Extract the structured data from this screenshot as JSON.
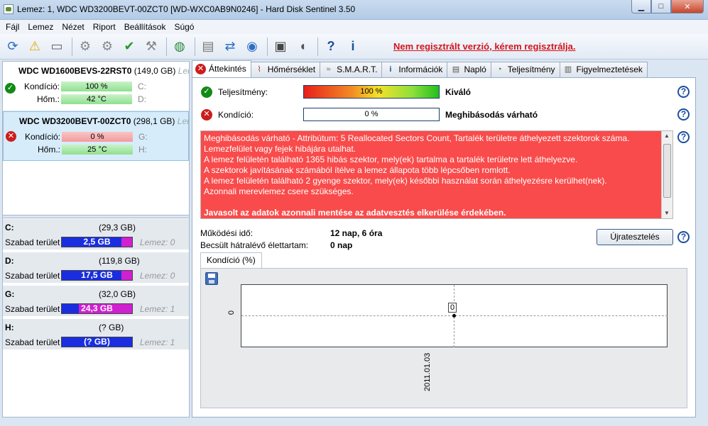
{
  "window": {
    "title": "Lemez: 1, WDC WD3200BEVT-00ZCT0 [WD-WXC0AB9N0246]  -  Hard Disk Sentinel 3.50"
  },
  "menu": [
    "Fájl",
    "Lemez",
    "Nézet",
    "Riport",
    "Beállítások",
    "Súgó"
  ],
  "toolbar": {
    "register_link": "Nem regisztrált verzió, kérem regisztrálja."
  },
  "disks": [
    {
      "name": "WDC WD1600BEVS-22RST0",
      "size": "(149,0 GB)",
      "extra": "Lem",
      "condition_label": "Kondíció:",
      "condition": "100 %",
      "temp_label": "Hőm.:",
      "temp": "42 °C",
      "drive1": "C:",
      "drive2": "D:"
    },
    {
      "name": "WDC WD3200BEVT-00ZCT0",
      "size": "(298,1 GB)",
      "extra": "Lem",
      "condition_label": "Kondíció:",
      "condition": "0 %",
      "temp_label": "Hőm.:",
      "temp": "25 °C",
      "drive1": "G:",
      "drive2": "H:"
    }
  ],
  "volumes": [
    {
      "letter": "C:",
      "size": "(29,3 GB)",
      "free_label": "Szabad terület",
      "free": "2,5 GB",
      "disk": "Lemez: 0",
      "fill": 0.85
    },
    {
      "letter": "D:",
      "size": "(119,8 GB)",
      "free_label": "Szabad terület",
      "free": "17,5 GB",
      "disk": "Lemez: 0",
      "fill": 0.85
    },
    {
      "letter": "G:",
      "size": "(32,0 GB)",
      "free_label": "Szabad terület",
      "free": "24,3 GB",
      "disk": "Lemez: 1",
      "fill": 0.24
    },
    {
      "letter": "H:",
      "size": "(? GB)",
      "free_label": "Szabad terület",
      "free": "(? GB)",
      "disk": "Lemez: 1",
      "fill": 1.0
    }
  ],
  "tabs": [
    "Áttekintés",
    "Hőmérséklet",
    "S.M.A.R.T.",
    "Információk",
    "Napló",
    "Teljesítmény",
    "Figyelmeztetések"
  ],
  "overview": {
    "performance_label": "Teljesítmény:",
    "performance_value": "100 %",
    "performance_text": "Kiváló",
    "condition_label": "Kondíció:",
    "condition_value": "0 %",
    "condition_text": "Meghibásodás várható",
    "message": [
      "Meghibásodás várható - Attribútum: 5 Reallocated Sectors Count, Tartalék területre áthelyezett szektorok száma.",
      "Lemezfelület vagy fejek hibájára utalhat.",
      "A lemez felületén található 1365 hibás szektor, mely(ek) tartalma a tartalék területre lett áthelyezve.",
      "A szektorok javításának számából ítélve a lemez állapota több lépcsőben romlott.",
      "A lemez felületén található 2 gyenge szektor, mely(ek) későbbi használat során áthelyezésre kerülhet(nek).",
      "Azonnali merevlemez csere szükséges.",
      "",
      "Javasolt az adatok azonnali mentése az adatvesztés elkerülése érdekében."
    ],
    "uptime_label": "Működési idő:",
    "uptime_value": "12 nap, 6 óra",
    "remaining_label": "Becsült hátralévő élettartam:",
    "remaining_value": "0 nap",
    "retest_label": "Újratesztelés",
    "chart_tab": "Kondíció  (%)"
  },
  "chart_data": {
    "type": "line",
    "x": [
      "2011.01.03"
    ],
    "series": [
      {
        "values": [
          0
        ]
      }
    ],
    "data_labels": [
      "0"
    ],
    "y_ticks": [
      "0"
    ],
    "grid": true
  }
}
